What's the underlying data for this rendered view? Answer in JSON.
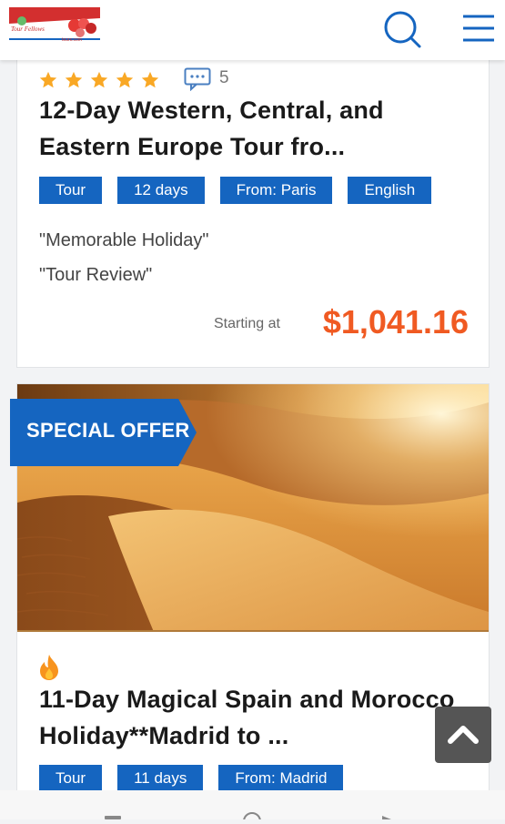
{
  "header": {
    "logo_text": "Tour Fellows",
    "logo_sub": "tours.com",
    "search_icon": "search-icon",
    "menu_icon": "hamburger-menu-icon"
  },
  "cards": [
    {
      "rating_stars": 5,
      "review_count": "5",
      "title": "12-Day Western, Central, and Eastern Europe Tour fro...",
      "tags": [
        "Tour",
        "12 days",
        "From: Paris",
        "English"
      ],
      "reviews": [
        "\"Memorable Holiday\"",
        "\"Tour Review\""
      ],
      "starting_label": "Starting at",
      "price": "$1,041.16"
    },
    {
      "badge": "SPECIAL OFFER",
      "image_alt": "desert-dunes-photo",
      "title": "11-Day Magical Spain and Morocco Holiday**Madrid to ...",
      "tags": [
        "Tour",
        "11 days",
        "From: Madrid"
      ]
    }
  ],
  "colors": {
    "brand_blue": "#1565c0",
    "price_orange": "#f05a22",
    "star_gold": "#f9a825"
  }
}
